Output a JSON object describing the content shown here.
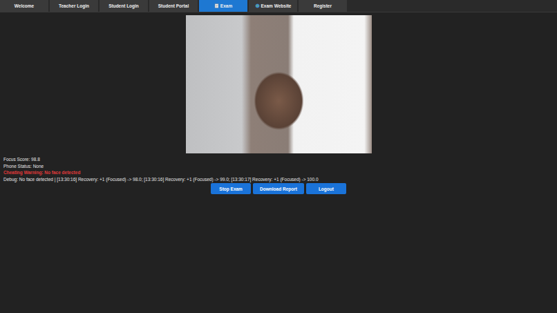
{
  "tabs": [
    {
      "label": "Welcome",
      "selected": false,
      "kind": "plain"
    },
    {
      "label": "Teacher Login",
      "selected": false,
      "kind": "plain"
    },
    {
      "label": "Student Login",
      "selected": false,
      "kind": "plain"
    },
    {
      "label": "Student Portal",
      "selected": false,
      "kind": "plain"
    },
    {
      "label": "Exam",
      "selected": true,
      "kind": "memo"
    },
    {
      "label": "Exam Website",
      "selected": false,
      "kind": "globe"
    },
    {
      "label": "Register",
      "selected": false,
      "kind": "plain"
    }
  ],
  "status": {
    "focus_score": "Focus Score: 98.8",
    "phone_status": "Phone Status: None",
    "warning": "Cheating Warning: No face detected",
    "debug": "Debug: No face detected | [13:30:16] Recovery: +1 (Focused) -> 98.0; [13:30:16] Recovery: +1 (Focused) -> 99.0; [13:30:17] Recovery: +1 (Focused) -> 100.0"
  },
  "buttons": [
    "Stop Exam",
    "Download Report",
    "Logout"
  ]
}
